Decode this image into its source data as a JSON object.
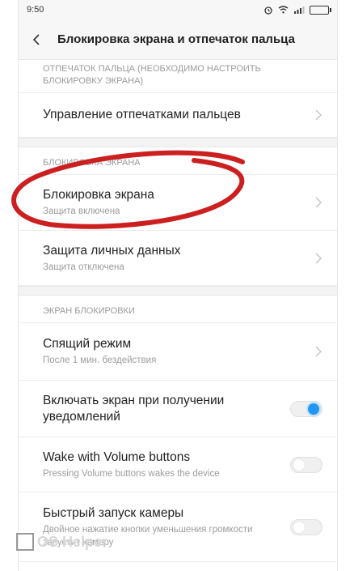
{
  "status_bar": {
    "time": "9:50"
  },
  "header": {
    "title": "Блокировка экрана и отпечаток пальца"
  },
  "sections": {
    "fingerprint": {
      "title": "ОТПЕЧАТОК ПАЛЬЦА (НЕОБХОДИМО НАСТРОИТЬ БЛОКИРОВКУ ЭКРАНА)",
      "items": [
        {
          "label": "Управление отпечатками пальцев"
        }
      ]
    },
    "lock": {
      "title": "БЛОКИРОВКА ЭКРАНА",
      "items": [
        {
          "label": "Блокировка экрана",
          "sub": "Защита включена"
        },
        {
          "label": "Защита личных данных",
          "sub": "Защита отключена"
        }
      ]
    },
    "lockscreen": {
      "title": "ЭКРАН БЛОКИРОВКИ",
      "items": [
        {
          "label": "Спящий режим",
          "sub": "После 1 мин. бездействия"
        },
        {
          "label": "Включать экран при получении уведомлений",
          "toggle": true
        },
        {
          "label": "Wake with Volume buttons",
          "sub": "Pressing Volume buttons wakes the device",
          "toggle": false
        },
        {
          "label": "Быстрый запуск камеры",
          "sub": "Двойное нажатие кнопки уменьшения громкости запустит камеру",
          "toggle": false
        }
      ]
    }
  },
  "watermark": {
    "text": "OS Helper"
  },
  "colors": {
    "accent": "#2196f3",
    "annotation": "#cc1f1f"
  }
}
